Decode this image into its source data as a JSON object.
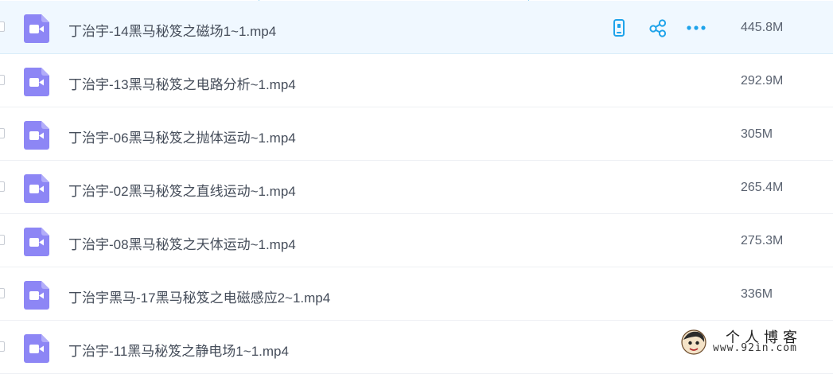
{
  "files": [
    {
      "name": "丁治宇-14黑马秘笈之磁场1~1.mp4",
      "size": "445.8M"
    },
    {
      "name": "丁治宇-13黑马秘笈之电路分析~1.mp4",
      "size": "292.9M"
    },
    {
      "name": "丁治宇-06黑马秘笈之抛体运动~1.mp4",
      "size": "305M"
    },
    {
      "name": "丁治宇-02黑马秘笈之直线运动~1.mp4",
      "size": "265.4M"
    },
    {
      "name": "丁治宇-08黑马秘笈之天体运动~1.mp4",
      "size": "275.3M"
    },
    {
      "name": "丁治宇黑马-17黑马秘笈之电磁感应2~1.mp4",
      "size": "336M"
    },
    {
      "name": "丁治宇-11黑马秘笈之静电场1~1.mp4",
      "size": ""
    }
  ],
  "hover_actions": [
    {
      "icon": "phone-icon"
    },
    {
      "icon": "share-icon"
    },
    {
      "icon": "more-icon"
    }
  ],
  "watermark": {
    "title": "个人博客",
    "url": "www.92in.com"
  },
  "colors": {
    "video_icon": "#8d86f5",
    "action_icon": "#1fa3ea",
    "hover_row": "#f0f8ff"
  }
}
